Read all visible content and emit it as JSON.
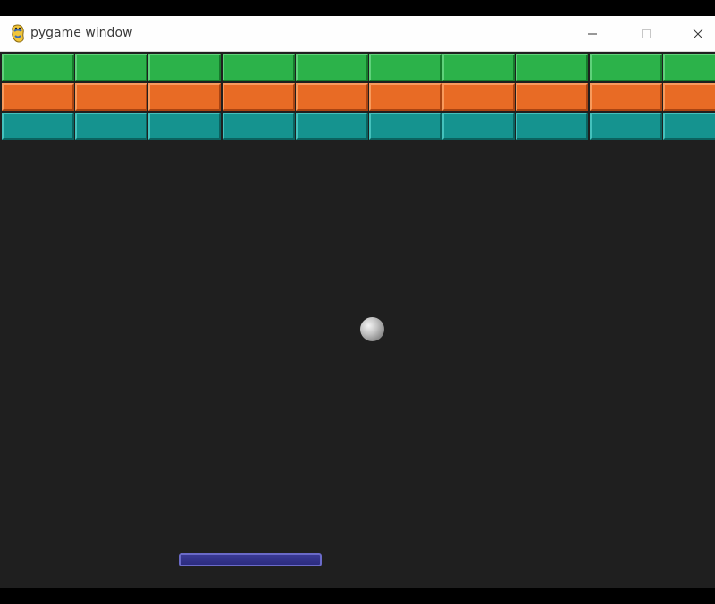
{
  "window": {
    "title": "pygame window",
    "app_icon": "pygame-snake-icon",
    "controls": {
      "minimize_icon": "minimize-icon",
      "maximize_icon": "maximize-icon",
      "close_icon": "close-icon"
    }
  },
  "game": {
    "background_color": "#1f1f1f",
    "brick_rows": [
      {
        "color": "green",
        "face": "#2cb24a",
        "light": "#5fd17a",
        "dark": "#167a2c",
        "bricks": 10
      },
      {
        "color": "orange",
        "face": "#e86b25",
        "light": "#f79a5c",
        "dark": "#a94412",
        "bricks": 10
      },
      {
        "color": "teal",
        "face": "#15938f",
        "light": "#44c1bc",
        "dark": "#0b625f",
        "bricks": 10
      }
    ],
    "paddle_color": "#2e2e84",
    "ball_color": "#bdbdbd"
  }
}
